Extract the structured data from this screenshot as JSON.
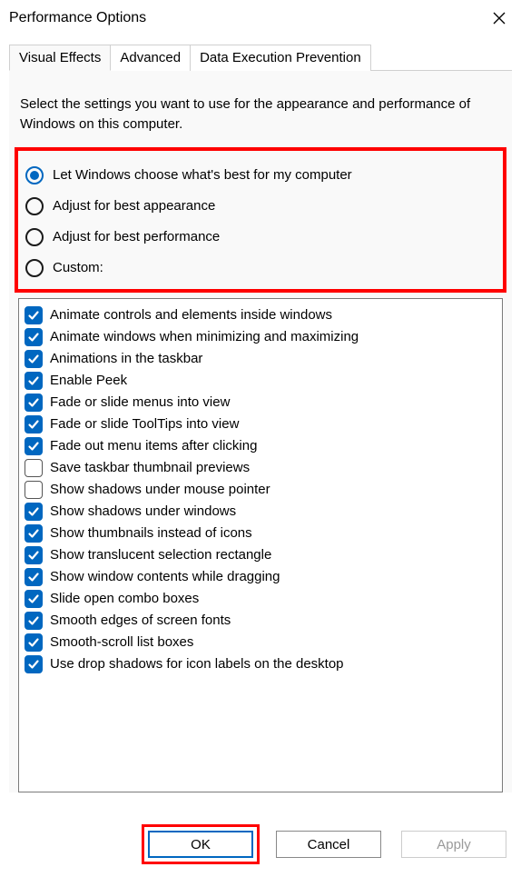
{
  "window": {
    "title": "Performance Options"
  },
  "tabs": {
    "visual_effects": "Visual Effects",
    "advanced": "Advanced",
    "dep": "Data Execution Prevention"
  },
  "intro": "Select the settings you want to use for the appearance and performance of Windows on this computer.",
  "radios": {
    "let_windows": {
      "label": "Let Windows choose what's best for my computer",
      "checked": true
    },
    "best_appearance": {
      "label": "Adjust for best appearance",
      "checked": false
    },
    "best_performance": {
      "label": "Adjust for best performance",
      "checked": false
    },
    "custom": {
      "label": "Custom:",
      "checked": false
    }
  },
  "checks": [
    {
      "label": "Animate controls and elements inside windows",
      "checked": true
    },
    {
      "label": "Animate windows when minimizing and maximizing",
      "checked": true
    },
    {
      "label": "Animations in the taskbar",
      "checked": true
    },
    {
      "label": "Enable Peek",
      "checked": true
    },
    {
      "label": "Fade or slide menus into view",
      "checked": true
    },
    {
      "label": "Fade or slide ToolTips into view",
      "checked": true
    },
    {
      "label": "Fade out menu items after clicking",
      "checked": true
    },
    {
      "label": "Save taskbar thumbnail previews",
      "checked": false
    },
    {
      "label": "Show shadows under mouse pointer",
      "checked": false
    },
    {
      "label": "Show shadows under windows",
      "checked": true
    },
    {
      "label": "Show thumbnails instead of icons",
      "checked": true
    },
    {
      "label": "Show translucent selection rectangle",
      "checked": true
    },
    {
      "label": "Show window contents while dragging",
      "checked": true
    },
    {
      "label": "Slide open combo boxes",
      "checked": true
    },
    {
      "label": "Smooth edges of screen fonts",
      "checked": true
    },
    {
      "label": "Smooth-scroll list boxes",
      "checked": true
    },
    {
      "label": "Use drop shadows for icon labels on the desktop",
      "checked": true
    }
  ],
  "buttons": {
    "ok": "OK",
    "cancel": "Cancel",
    "apply": "Apply"
  }
}
